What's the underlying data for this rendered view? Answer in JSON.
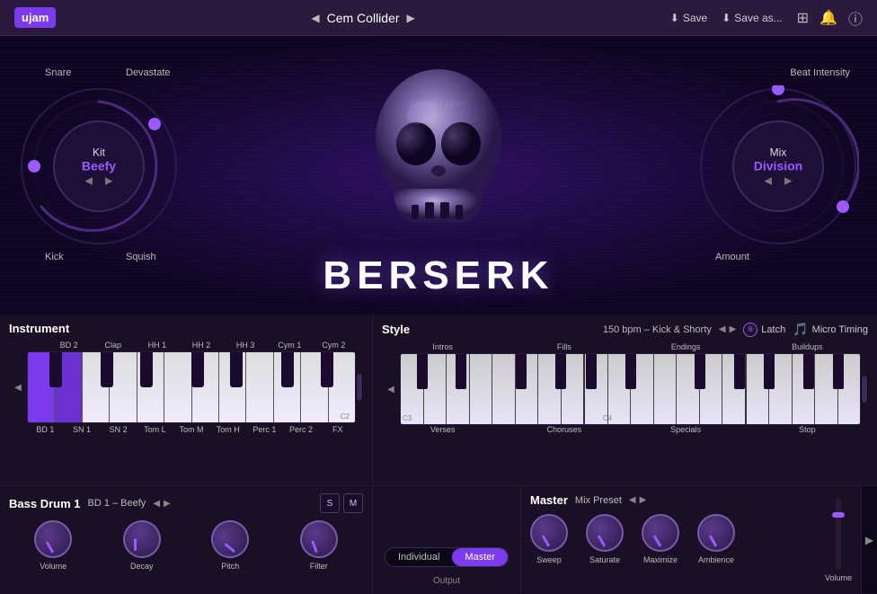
{
  "topbar": {
    "logo": "ujam",
    "preset_name": "Cem Collider",
    "save_label": "Save",
    "save_as_label": "Save as...",
    "nav_prev": "◀",
    "nav_next": "▶"
  },
  "hero": {
    "beatmaker_label": "beatMaker",
    "title": "BERSERK",
    "kit": {
      "label": "Kit",
      "value": "Beefy",
      "prev": "◀",
      "next": "▶"
    },
    "mix": {
      "label": "Mix",
      "value": "Division",
      "prev": "◀",
      "next": "▶"
    },
    "labels": {
      "snare": "Snare",
      "devastate": "Devastate",
      "kick": "Kick",
      "squish": "Squish",
      "amount": "Amount",
      "beat_intensity": "Beat Intensity"
    }
  },
  "instrument": {
    "title": "Instrument",
    "keys_top": [
      "BD 2",
      "Clap",
      "HH 1",
      "HH 2",
      "HH 3",
      "Cym 1",
      "Cym 2"
    ],
    "keys_bottom": [
      "BD 1",
      "SN 1",
      "SN 2",
      "Tom L",
      "Tom M",
      "Tom H",
      "Perc 1",
      "Perc 2",
      "FX"
    ],
    "note": "C2"
  },
  "style": {
    "title": "Style",
    "bpm": "150 bpm – Kick & Shorty",
    "nav_prev": "◀",
    "nav_next": "▶",
    "latch_label": "Latch",
    "micro_timing_label": "Micro Timing",
    "sections_top": [
      "Intros",
      "Fills",
      "Endings",
      "Buildups"
    ],
    "sections_bottom": [
      "Verses",
      "Choruses",
      "Specials",
      "Stop"
    ],
    "note_c3": "C3",
    "note_c4": "C4"
  },
  "bass_drum": {
    "title": "Bass Drum 1",
    "preset": "BD 1 – Beefy",
    "nav_prev": "◀",
    "nav_next": "▶",
    "s_label": "S",
    "m_label": "M",
    "knobs": [
      {
        "label": "Volume"
      },
      {
        "label": "Decay"
      },
      {
        "label": "Pitch"
      },
      {
        "label": "Filter"
      }
    ]
  },
  "output": {
    "individual_label": "Individual",
    "master_label": "Master",
    "label": "Output"
  },
  "master": {
    "title": "Master",
    "mix_preset_label": "Mix Preset",
    "nav_prev": "◀",
    "nav_next": "▶",
    "knobs": [
      {
        "label": "Sweep"
      },
      {
        "label": "Saturate"
      },
      {
        "label": "Maximize"
      },
      {
        "label": "Ambience"
      }
    ],
    "volume_label": "Volume"
  }
}
